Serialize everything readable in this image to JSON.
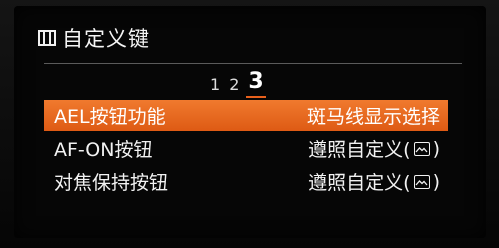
{
  "header": {
    "icon": "custom-key-menu-icon",
    "title": "自定义键"
  },
  "pagination": {
    "pages": [
      "1",
      "2",
      "3"
    ],
    "current": "3"
  },
  "rows": [
    {
      "label": "AEL按钮功能",
      "value": "斑马线显示选择",
      "selected": true
    },
    {
      "label": "AF-ON按钮",
      "value_prefix": "遵照自定义(",
      "value_icon": "image-icon",
      "value_suffix": ")",
      "selected": false
    },
    {
      "label": "对焦保持按钮",
      "value_prefix": "遵照自定义(",
      "value_icon": "image-icon",
      "value_suffix": ")",
      "selected": false
    }
  ],
  "colors": {
    "accent": "#e8601c",
    "background": "#060606",
    "text": "#f2f2f2"
  }
}
